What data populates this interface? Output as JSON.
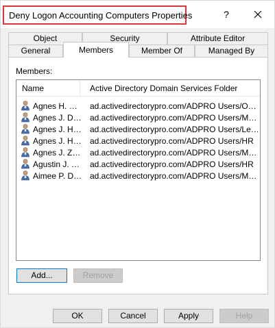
{
  "window": {
    "title": "Deny Logon Accounting Computers Properties",
    "help_glyph": "?",
    "close_icon": "close-icon"
  },
  "tabs": {
    "row1": [
      {
        "label": "Object"
      },
      {
        "label": "Security"
      },
      {
        "label": "Attribute Editor"
      }
    ],
    "row2": [
      {
        "label": "General"
      },
      {
        "label": "Members",
        "active": true
      },
      {
        "label": "Member Of"
      },
      {
        "label": "Managed By"
      }
    ]
  },
  "members": {
    "label": "Members:",
    "columns": [
      "Name",
      "Active Directory Domain Services Folder"
    ],
    "rows": [
      {
        "name": "Agnes H. Oue...",
        "folder": "ad.activedirectorypro.com/ADPRO Users/Operat..."
      },
      {
        "name": "Agnes J. Dibble",
        "folder": "ad.activedirectorypro.com/ADPRO Users/Mana..."
      },
      {
        "name": "Agnes J. Harris",
        "folder": "ad.activedirectorypro.com/ADPRO Users/Legal"
      },
      {
        "name": "Agnes J. Hay...",
        "folder": "ad.activedirectorypro.com/ADPRO Users/HR"
      },
      {
        "name": "Agnes J. Zarate",
        "folder": "ad.activedirectorypro.com/ADPRO Users/Mana..."
      },
      {
        "name": "Agustin J. Mejia",
        "folder": "ad.activedirectorypro.com/ADPRO Users/HR"
      },
      {
        "name": "Aimee P. Delk",
        "folder": "ad.activedirectorypro.com/ADPRO Users/Marke..."
      }
    ],
    "add_label": "Add...",
    "remove_label": "Remove"
  },
  "footer": {
    "ok_label": "OK",
    "cancel_label": "Cancel",
    "apply_label": "Apply",
    "help_label": "Help"
  },
  "colors": {
    "title_highlight": "#e0343b",
    "focus_border": "#0078d7"
  }
}
